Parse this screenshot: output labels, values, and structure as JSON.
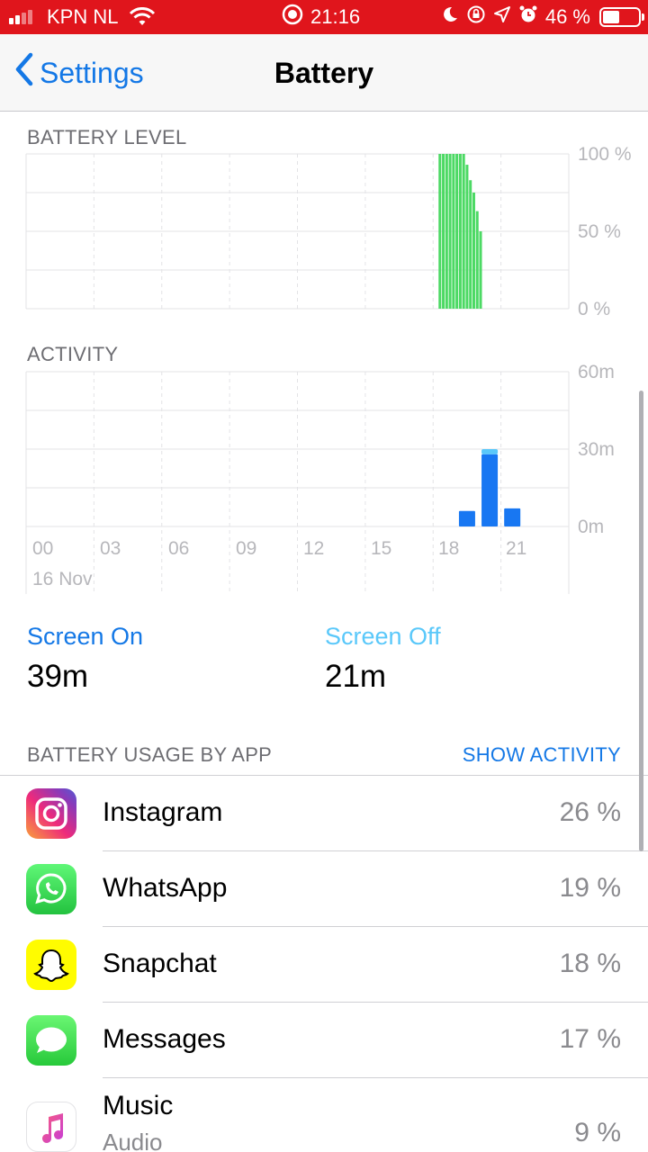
{
  "status_bar": {
    "carrier": "KPN NL",
    "time": "21:16",
    "battery_percent": "46 %"
  },
  "nav": {
    "back_label": "Settings",
    "title": "Battery"
  },
  "battery_level": {
    "label": "BATTERY LEVEL",
    "y_ticks": [
      "100 %",
      "50 %",
      "0 %"
    ]
  },
  "activity": {
    "label": "ACTIVITY",
    "y_ticks": [
      "60m",
      "30m",
      "0m"
    ],
    "x_ticks": [
      "00",
      "03",
      "06",
      "09",
      "12",
      "15",
      "18",
      "21"
    ],
    "date": "16 Nov"
  },
  "stats": {
    "screen_on_label": "Screen On",
    "screen_on_value": "39m",
    "screen_off_label": "Screen Off",
    "screen_off_value": "21m"
  },
  "usage": {
    "header": "BATTERY USAGE BY APP",
    "show_activity": "SHOW ACTIVITY",
    "apps": [
      {
        "name": "Instagram",
        "percent": "26 %",
        "icon": "instagram-icon"
      },
      {
        "name": "WhatsApp",
        "percent": "19 %",
        "icon": "whatsapp-icon"
      },
      {
        "name": "Snapchat",
        "percent": "18 %",
        "icon": "snapchat-icon"
      },
      {
        "name": "Messages",
        "percent": "17 %",
        "icon": "messages-icon"
      },
      {
        "name": "Music",
        "percent": "9 %",
        "icon": "music-icon",
        "subtitle": "Audio"
      }
    ]
  },
  "colors": {
    "status_bar": "#e0151c",
    "accent": "#1478e6",
    "battery_bar": "#4cd964",
    "activity_screen_on": "#1877f2",
    "activity_screen_off": "#5ac8fa"
  },
  "chart_data": [
    {
      "type": "bar",
      "title": "BATTERY LEVEL",
      "x_unit": "hour",
      "x": [
        18.3,
        18.45,
        18.6,
        18.75,
        18.9,
        19.05,
        19.2,
        19.35,
        19.5,
        19.65,
        19.8,
        19.95,
        20.1
      ],
      "values": [
        100,
        100,
        100,
        100,
        100,
        100,
        100,
        100,
        93,
        83,
        75,
        63,
        50
      ],
      "ylim": [
        0,
        100
      ],
      "xlim": [
        0,
        24
      ],
      "y_tick_labels": [
        "100 %",
        "50 %",
        "0 %"
      ]
    },
    {
      "type": "bar",
      "title": "ACTIVITY",
      "categories_hour": [
        19,
        20,
        21
      ],
      "x_tick_labels": [
        "00",
        "03",
        "06",
        "09",
        "12",
        "15",
        "18",
        "21"
      ],
      "series": [
        {
          "name": "Screen On",
          "values": [
            6,
            28,
            7
          ]
        },
        {
          "name": "Screen Off",
          "values": [
            0,
            2,
            0
          ]
        }
      ],
      "ylim": [
        0,
        60
      ],
      "y_tick_labels": [
        "60m",
        "30m",
        "0m"
      ],
      "xlim": [
        0,
        24
      ]
    }
  ]
}
